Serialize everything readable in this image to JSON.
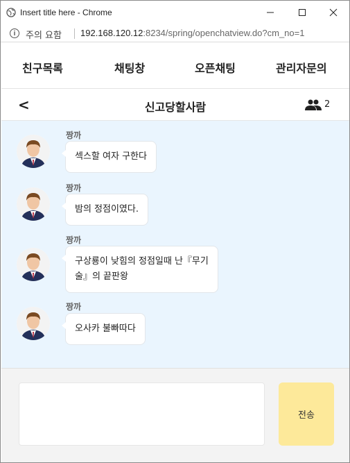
{
  "browser": {
    "title": "Insert title here - Chrome",
    "security_warning": "주의 요함",
    "url_host": "192.168.120.12",
    "url_rest": ":8234/spring/openchatview.do?cm_no=1"
  },
  "nav": {
    "items": [
      "친구목록",
      "채팅창",
      "오픈채팅",
      "관리자문의"
    ]
  },
  "chat": {
    "back_label": "<",
    "room_title": "신고당할사람",
    "member_count": "2"
  },
  "messages": [
    {
      "sender": "짱까",
      "text_lines": [
        "섹스할 여자 구한다"
      ]
    },
    {
      "sender": "짱까",
      "text_lines": [
        "밤의 정점이였다."
      ]
    },
    {
      "sender": "짱까",
      "text_lines": [
        "구상룡이 낮힘의 정점일때 난『무기",
        "술』의 끝판왕"
      ]
    },
    {
      "sender": "짱까",
      "text_lines": [
        "오사카 불빠따다"
      ]
    }
  ],
  "composer": {
    "send_label": "전송",
    "input_value": ""
  },
  "colors": {
    "chat_bg": "#eaf5fe",
    "send_button": "#fde99a"
  }
}
